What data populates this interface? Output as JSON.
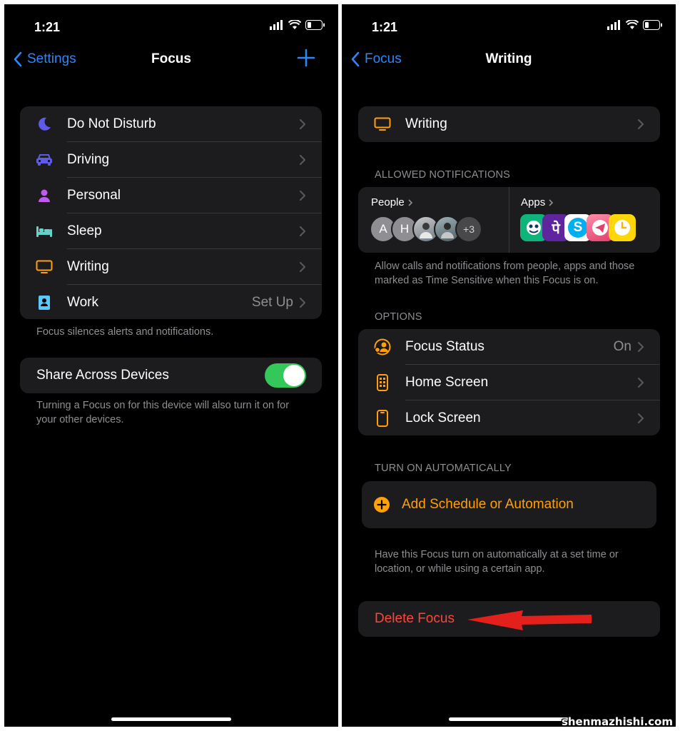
{
  "left": {
    "status": {
      "time": "1:21"
    },
    "nav": {
      "back_label": "Settings",
      "title": "Focus"
    },
    "focus_list": [
      {
        "label": "Do Not Disturb",
        "value": "",
        "icon": "moon-icon",
        "color": "#5e5ce6"
      },
      {
        "label": "Driving",
        "value": "",
        "icon": "car-icon",
        "color": "#5e5ce6"
      },
      {
        "label": "Personal",
        "value": "",
        "icon": "person-icon",
        "color": "#bf5af2"
      },
      {
        "label": "Sleep",
        "value": "",
        "icon": "bed-icon",
        "color": "#64d2c8"
      },
      {
        "label": "Writing",
        "value": "",
        "icon": "monitor-icon",
        "color": "#ff9f0a"
      },
      {
        "label": "Work",
        "value": "Set Up",
        "icon": "id-badge-icon",
        "color": "#5ac8fa"
      }
    ],
    "focus_footer": "Focus silences alerts and notifications.",
    "share": {
      "label": "Share Across Devices",
      "enabled": true
    },
    "share_footer": "Turning a Focus on for this device will also turn it on for your other devices."
  },
  "right": {
    "status": {
      "time": "1:21"
    },
    "nav": {
      "back_label": "Focus",
      "title": "Writing"
    },
    "writing_row": {
      "label": "Writing",
      "icon": "monitor-icon"
    },
    "allowed_header": "ALLOWED NOTIFICATIONS",
    "people": {
      "label": "People",
      "avatars": [
        "A",
        "H",
        "",
        ""
      ],
      "more": "+3"
    },
    "apps": {
      "label": "Apps",
      "icons": [
        "green-app-icon",
        "phonepe-icon",
        "skype-icon",
        "telegram-icon",
        "clock-app-icon"
      ],
      "phonepe_glyph": "पे",
      "skype_glyph": "S"
    },
    "allowed_footer": "Allow calls and notifications from people, apps and those marked as Time Sensitive when this Focus is on.",
    "options_header": "OPTIONS",
    "options": [
      {
        "label": "Focus Status",
        "value": "On",
        "icon": "focus-status-icon"
      },
      {
        "label": "Home Screen",
        "value": "",
        "icon": "home-screen-icon"
      },
      {
        "label": "Lock Screen",
        "value": "",
        "icon": "lock-screen-icon"
      }
    ],
    "auto_header": "TURN ON AUTOMATICALLY",
    "add_schedule": "Add Schedule or Automation",
    "auto_footer": "Have this Focus turn on automatically at a set time or location, or while using a certain app.",
    "delete_label": "Delete Focus"
  },
  "colors": {
    "accent_blue": "#2f86f5",
    "orange": "#ff9f0a",
    "red": "#ff453a",
    "toggle_green": "#34c759",
    "arrow_red": "#e3201b"
  },
  "watermark": "shenmazhishi.com"
}
